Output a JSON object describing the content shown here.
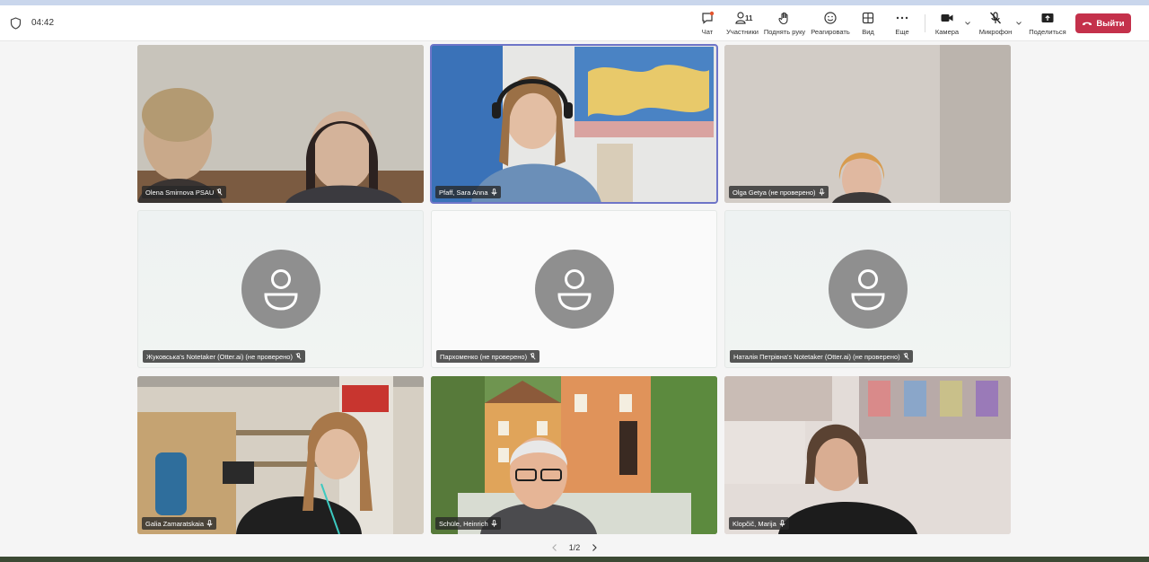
{
  "meeting": {
    "timer": "04:42"
  },
  "toolbar": {
    "chat": {
      "label": "Чат",
      "icon": "chat-icon"
    },
    "participants": {
      "label": "Участники",
      "count": "11",
      "icon": "people-icon"
    },
    "raise_hand": {
      "label": "Поднять руку",
      "icon": "hand-icon"
    },
    "react": {
      "label": "Реагировать",
      "icon": "smile-icon"
    },
    "view": {
      "label": "Вид",
      "icon": "grid-icon"
    },
    "more": {
      "label": "Еще",
      "icon": "more-icon"
    },
    "camera": {
      "label": "Камера",
      "icon": "camera-icon"
    },
    "microphone": {
      "label": "Микрофон",
      "icon": "mic-off-icon"
    },
    "share": {
      "label": "Поделиться",
      "icon": "share-icon"
    },
    "leave": {
      "label": "Выйти",
      "icon": "phone-hangup-icon",
      "color": "#c4314b"
    }
  },
  "participants": [
    {
      "name": "Olena Smirnova PSAU",
      "video": true
    },
    {
      "name": "Pfaff, Sara Anna",
      "video": true,
      "active": true
    },
    {
      "name": "Olga Getya (не проверено)",
      "video": true
    },
    {
      "name": "Жуковська's Notetaker (Otter.ai) (не проверено)",
      "video": false
    },
    {
      "name": "Пархоменко (не проверено)",
      "video": false
    },
    {
      "name": "Наталія Петрівна's Notetaker (Otter.ai) (не проверено)",
      "video": false
    },
    {
      "name": "Galia Zamaratskaia",
      "video": true
    },
    {
      "name": "Schüle, Heinrich",
      "video": true
    },
    {
      "name": "Klopčič, Marija",
      "video": true
    }
  ],
  "pager": {
    "text": "1/2"
  }
}
